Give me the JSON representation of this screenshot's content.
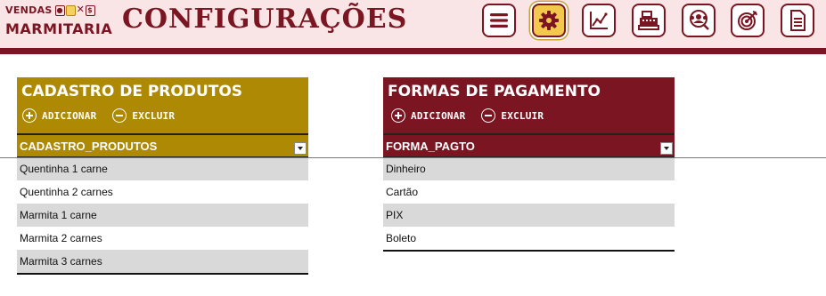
{
  "app": {
    "logo_line1": "VENDAS",
    "logo_line2": "MARMITARIA",
    "page_title": "CONFIGURAÇÕES"
  },
  "nav": [
    {
      "name": "menu-icon"
    },
    {
      "name": "gear-icon",
      "active": true
    },
    {
      "name": "chart-icon"
    },
    {
      "name": "cash-register-icon"
    },
    {
      "name": "customers-icon"
    },
    {
      "name": "target-icon"
    },
    {
      "name": "document-icon"
    }
  ],
  "colors": {
    "wine": "#7b1521",
    "gold": "#ae8904",
    "header_bg": "#f9e4e6"
  },
  "products": {
    "title": "CADASTRO DE PRODUTOS",
    "add_label": "ADICIONAR",
    "remove_label": "EXCLUIR",
    "column": "CADASTRO_PRODUTOS",
    "rows": [
      "Quentinha 1 carne",
      "Quentinha 2 carnes",
      "Marmita 1 carne",
      "Marmita 2 carnes",
      "Marmita 3 carnes"
    ]
  },
  "payments": {
    "title": "FORMAS DE PAGAMENTO",
    "add_label": "ADICIONAR",
    "remove_label": "EXCLUIR",
    "column": "FORMA_PAGTO",
    "rows": [
      "Dinheiro",
      "Cartão",
      "PIX",
      "Boleto"
    ]
  }
}
